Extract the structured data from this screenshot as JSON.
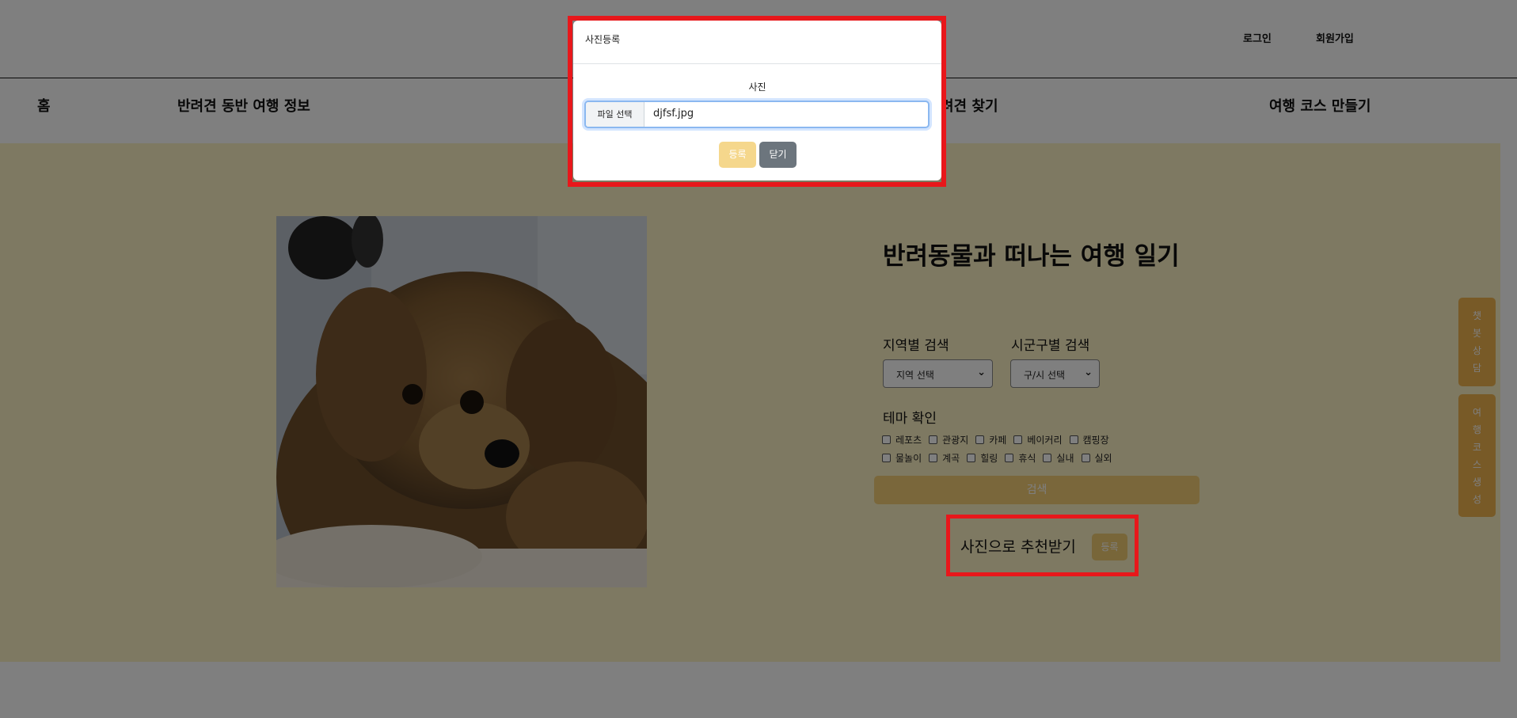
{
  "header": {
    "login": "로그인",
    "signup": "회원가입"
  },
  "nav": {
    "home": "홈",
    "travel_info": "반려견 동반 여행 정보",
    "find_dog": "려견 찾기",
    "course": "여행 코스 만들기"
  },
  "main": {
    "title": "반려동물과 떠나는 여행 일기",
    "region_label": "지역별 검색",
    "region_select": "지역 선택",
    "district_label": "시군구별 검색",
    "district_select": "구/시 선택",
    "theme_label": "테마 확인",
    "themes_row1": [
      "레포츠",
      "관광지",
      "카페",
      "베이커리",
      "캠핑장"
    ],
    "themes_row2": [
      "물놀이",
      "계곡",
      "힐링",
      "휴식",
      "실내",
      "실외"
    ],
    "search_button": "검색",
    "photo_recommend_label": "사진으로 추천받기",
    "photo_register_button": "등록"
  },
  "side": {
    "chat": [
      "챗",
      "봇",
      "상",
      "담"
    ],
    "course": [
      "여",
      "행",
      "코",
      "스",
      "생",
      "성"
    ]
  },
  "modal": {
    "title": "사진등록",
    "field_label": "사진",
    "file_button": "파일 선택",
    "file_name": "djfsf.jpg",
    "register_button": "등록",
    "close_button": "닫기"
  },
  "colors": {
    "accent": "#f0b54f",
    "hero_bg": "#fdf2c4",
    "highlight": "#e8171b"
  }
}
